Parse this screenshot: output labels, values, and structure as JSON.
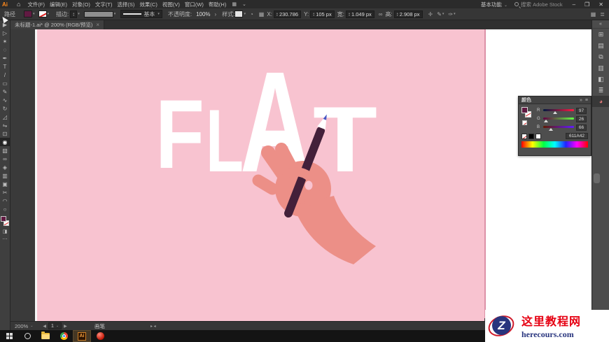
{
  "titlebar": {
    "app_label": "Ai",
    "menus": [
      "文件(F)",
      "编辑(E)",
      "对象(O)",
      "文字(T)",
      "选择(S)",
      "效果(C)",
      "视图(V)",
      "窗口(W)",
      "帮助(H)"
    ],
    "layout_switch_glyph": "▦",
    "workspace": "基本功能",
    "search_placeholder": "搜索 Adobe Stock",
    "minimize_label": "–",
    "restore_label": "❐",
    "close_label": "✕"
  },
  "options_bar": {
    "context_label": "路径",
    "stroke_label": "描边:",
    "stroke_style_label": "基本",
    "opacity_label": "不透明度:",
    "opacity_value": "100%",
    "opacity_more": "›",
    "style_label": "样式:",
    "recolor_glyph": "◔",
    "transform_grid_glyph": "▦",
    "x_label": "X:",
    "x_value": "230.786",
    "y_label": "Y:",
    "y_value": "105 px",
    "w_label": "宽:",
    "w_value": "1.049 px",
    "link_glyph": "∞",
    "h_label": "高:",
    "h_value": "2.908 px",
    "transform_glyph": "✛",
    "align_glyph": "✎",
    "brush_opts_glyph": "✑",
    "arrange_docs_glyph": "▦",
    "panel_menu_glyph": "≣"
  },
  "document_tab": {
    "title": "未标题-1.ai* @ 200% (RGB/预览)",
    "close_label": "×"
  },
  "toolbar": {
    "active_index": 14,
    "tools": [
      {
        "name": "selection-tool-icon",
        "glyph": "▶"
      },
      {
        "name": "direct-selection-tool-icon",
        "glyph": "▷"
      },
      {
        "name": "magic-wand-tool-icon",
        "glyph": "✶"
      },
      {
        "name": "lasso-tool-icon",
        "glyph": "◌"
      },
      {
        "name": "pen-tool-icon",
        "glyph": "✒"
      },
      {
        "name": "type-tool-icon",
        "glyph": "T"
      },
      {
        "name": "line-segment-tool-icon",
        "glyph": "/"
      },
      {
        "name": "rectangle-tool-icon",
        "glyph": "▭"
      },
      {
        "name": "paintbrush-tool-icon",
        "glyph": "✎"
      },
      {
        "name": "pencil-tool-icon",
        "glyph": "∿"
      },
      {
        "name": "rotate-tool-icon",
        "glyph": "↻"
      },
      {
        "name": "scale-tool-icon",
        "glyph": "◿"
      },
      {
        "name": "width-tool-icon",
        "glyph": "⇋"
      },
      {
        "name": "free-transform-tool-icon",
        "glyph": "⊡"
      },
      {
        "name": "eyedropper-tool-icon",
        "glyph": "◉"
      },
      {
        "name": "gradient-tool-icon",
        "glyph": "▧"
      },
      {
        "name": "blend-tool-icon",
        "glyph": "∞"
      },
      {
        "name": "symbol-sprayer-tool-icon",
        "glyph": "◈"
      },
      {
        "name": "column-graph-tool-icon",
        "glyph": "▥"
      },
      {
        "name": "artboard-tool-icon",
        "glyph": "▣"
      },
      {
        "name": "slice-tool-icon",
        "glyph": "✂"
      },
      {
        "name": "hand-tool-icon",
        "glyph": "◠"
      },
      {
        "name": "zoom-tool-icon",
        "glyph": "○"
      }
    ],
    "draw-mode_glyph": "◨",
    "more_glyph": "⋯"
  },
  "canvas": {
    "letters": [
      "F",
      "L",
      "A",
      "T"
    ],
    "background_color": "#F8C3D0",
    "letter_color": "#FFFFFF",
    "hand_color": "#EC8F87",
    "pencil_color": "#43203A",
    "pencil_lead_color": "#4656C4",
    "artboard_edge_color": "#DC92A8"
  },
  "color_panel": {
    "title": "颜色",
    "collapse_glyph": "»",
    "menu_glyph": "≡",
    "channels": [
      {
        "label": "R",
        "value": 97
      },
      {
        "label": "G",
        "value": 26
      },
      {
        "label": "B",
        "value": 66
      }
    ],
    "hex_value": "611A42",
    "fill_color": "#611A42"
  },
  "dock": {
    "collapse_glyph": "«",
    "active_index": 6,
    "icons": [
      {
        "name": "swatches-panel-icon",
        "glyph": "⊞"
      },
      {
        "name": "brushes-panel-icon",
        "glyph": "▤"
      },
      {
        "name": "symbols-panel-icon",
        "glyph": "⧉"
      },
      {
        "name": "graphic-styles-panel-icon",
        "glyph": "▥"
      },
      {
        "name": "layers-panel-icon",
        "glyph": "◧"
      },
      {
        "name": "libraries-panel-icon",
        "glyph": "≣"
      },
      {
        "name": "color-panel-icon",
        "glyph": "◕"
      }
    ]
  },
  "status_bar": {
    "zoom_value": "200%",
    "nav_prev": "◀",
    "nav_next": "▶",
    "artboard_value": "1",
    "tool_name": "画笔",
    "collapse_arrows": "▸ ◂"
  },
  "taskbar": {
    "ai_label": "Ai"
  },
  "watermark": {
    "logo_letter": "Z",
    "site_name": "这里教程网",
    "site_url": "herecours.com",
    "name_color": "#E60012",
    "url_color": "#28357E"
  }
}
